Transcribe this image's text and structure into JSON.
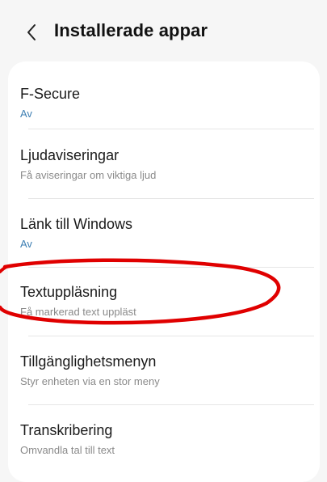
{
  "header": {
    "back_icon": "chevron-left-icon",
    "title": "Installerade appar"
  },
  "items": [
    {
      "title": "F-Secure",
      "subtitle": "Av",
      "subtitle_color": "#3e7fb3"
    },
    {
      "title": "Ljudaviseringar",
      "subtitle": "Få aviseringar om viktiga ljud",
      "subtitle_color": "#8a8a8a"
    },
    {
      "title": "Länk till Windows",
      "subtitle": "Av",
      "subtitle_color": "#3e7fb3"
    },
    {
      "title": "Textuppläsning",
      "subtitle": "Få markerad text uppläst",
      "subtitle_color": "#8a8a8a"
    },
    {
      "title": "Tillgänglighetsmenyn",
      "subtitle": "Styr enheten via en stor meny",
      "subtitle_color": "#8a8a8a"
    },
    {
      "title": "Transkribering",
      "subtitle": "Omvandla tal till text",
      "subtitle_color": "#8a8a8a"
    }
  ],
  "annotation": {
    "type": "hand-drawn-ellipse",
    "color": "#e00000",
    "target": "Textuppläsning"
  }
}
